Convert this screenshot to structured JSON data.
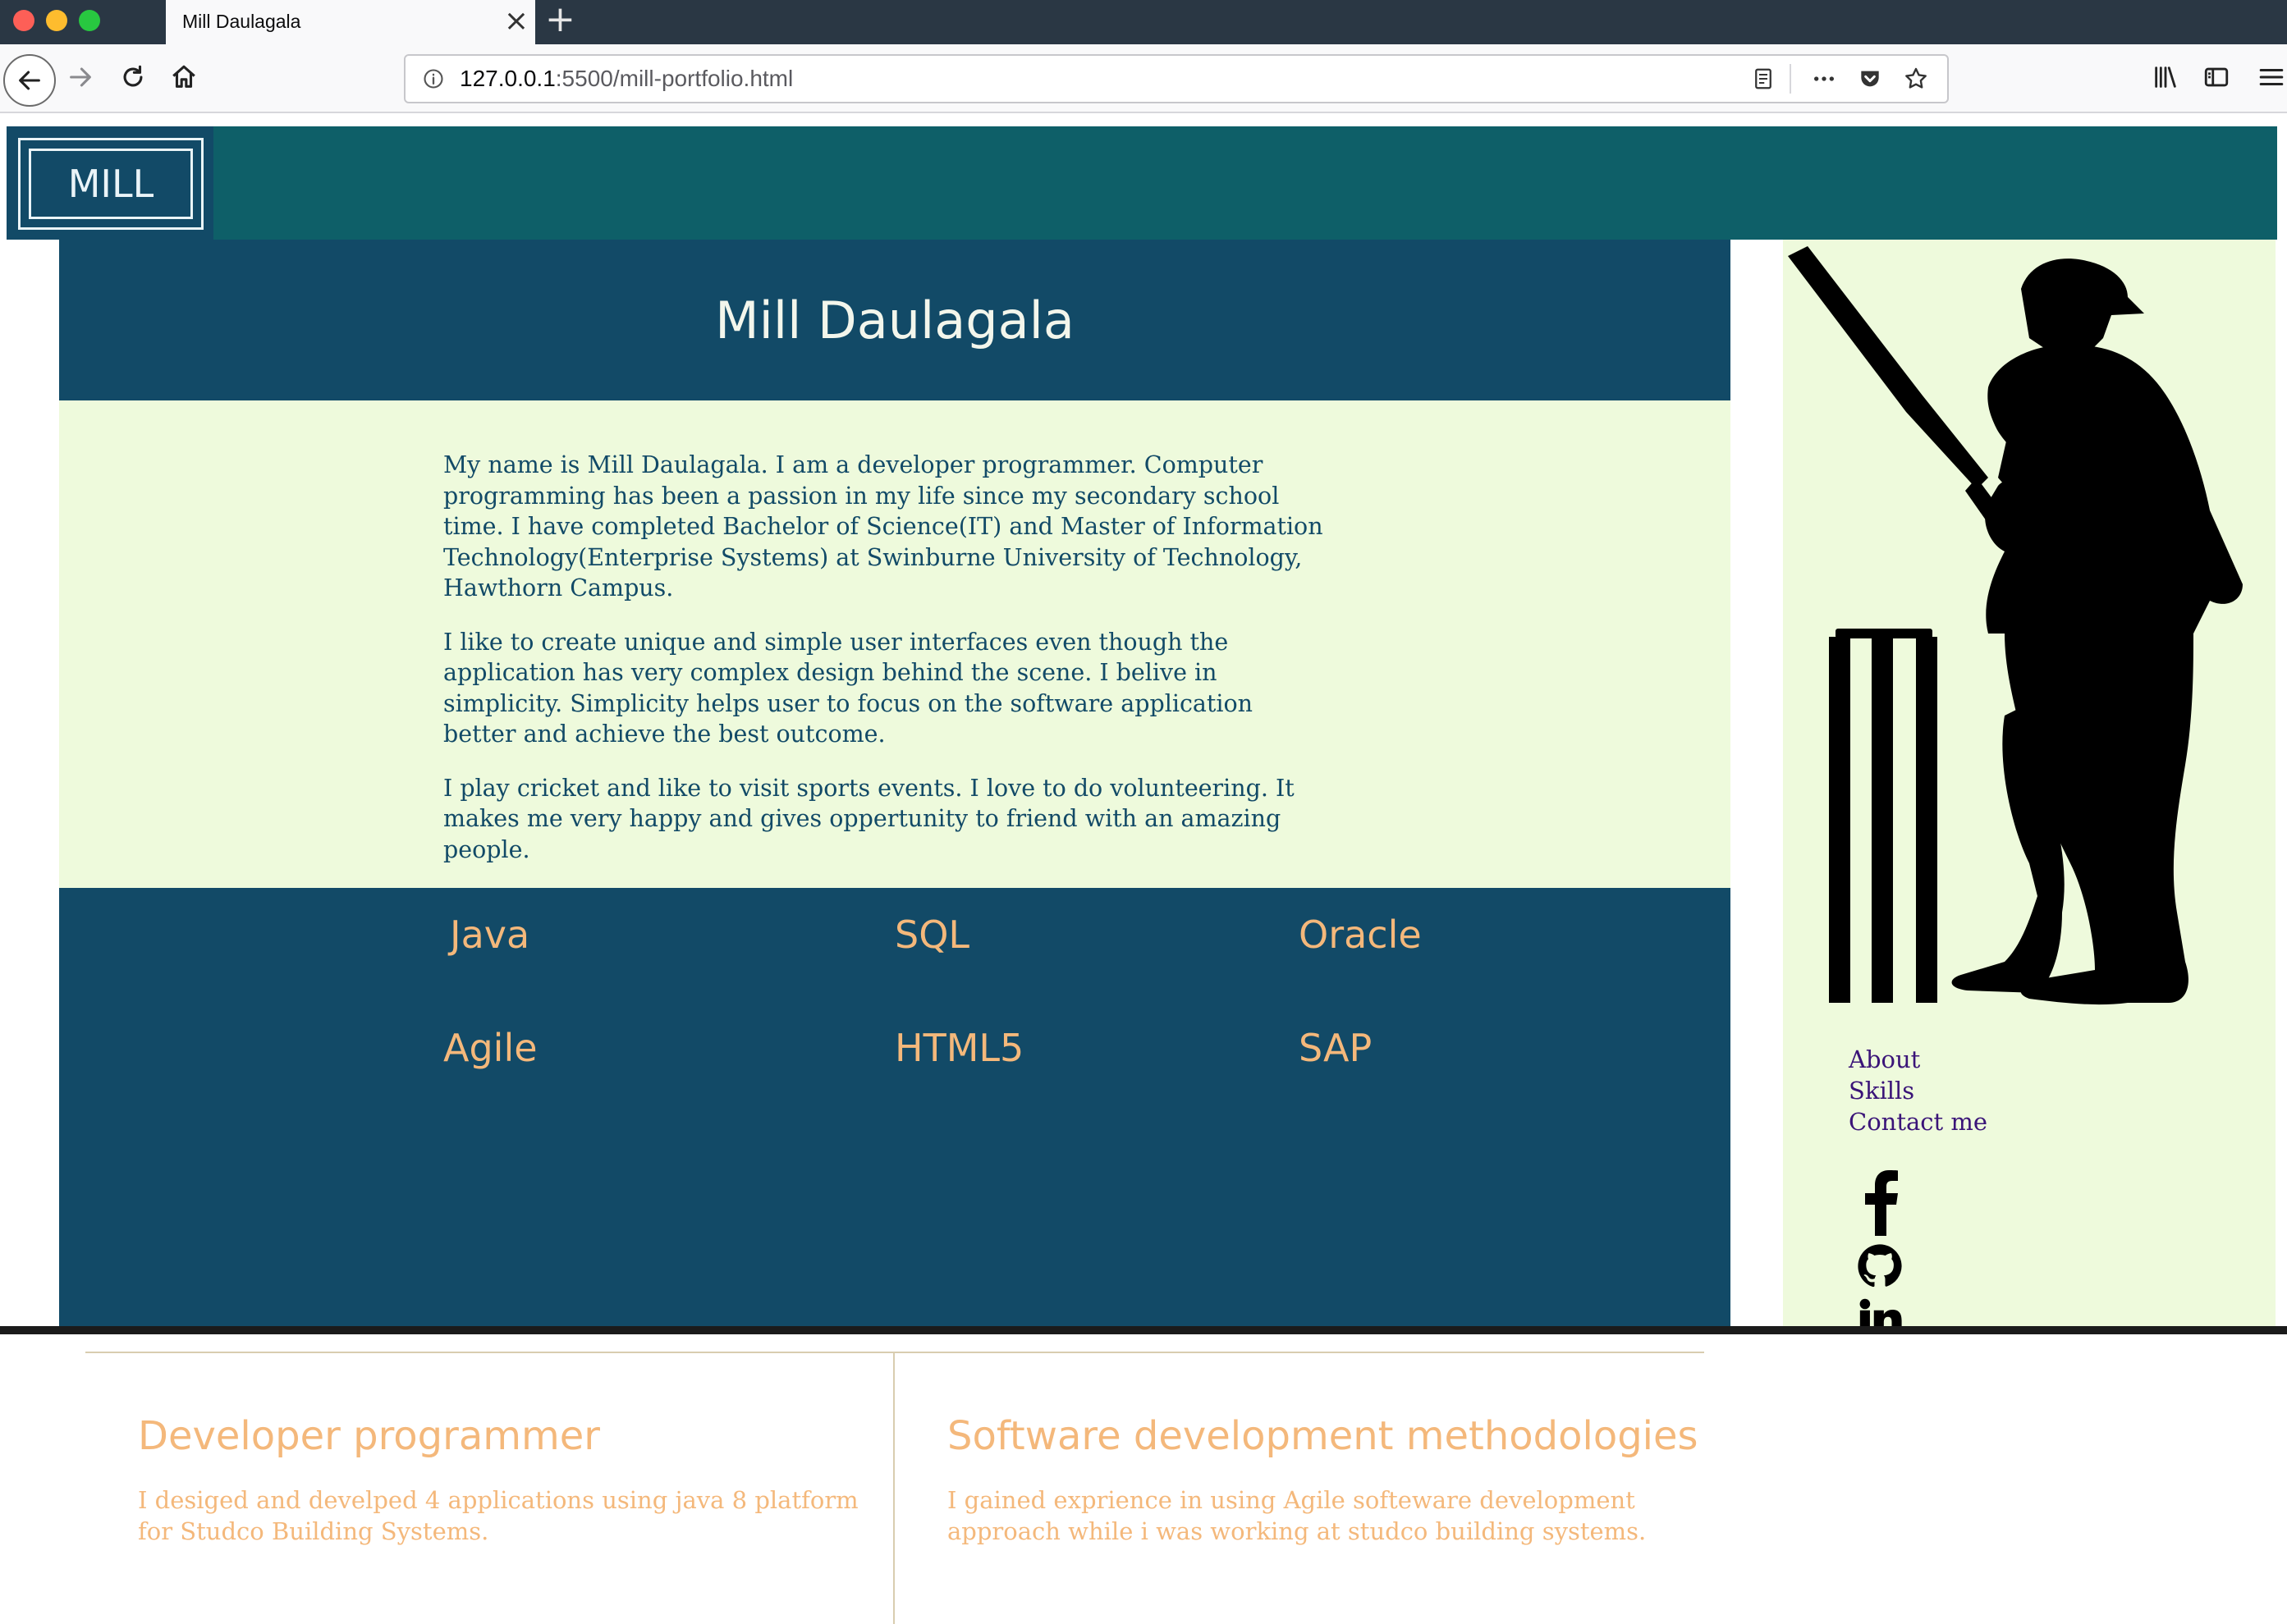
{
  "browser": {
    "tab_title": "Mill Daulagala",
    "url_host": "127.0.0.1",
    "url_rest": ":5500/mill-portfolio.html"
  },
  "header": {
    "logo": "MILL"
  },
  "hero": {
    "title": "Mill Daulagala"
  },
  "about": {
    "paragraphs": [
      "My name is Mill Daulagala. I am a developer programmer. Computer programming has been a passion in my life since my secondary school time. I have completed Bachelor of Science(IT) and Master of Information Technology(Enterprise Systems) at Swinburne University of Technology, Hawthorn Campus.",
      "I like to create unique and simple user interfaces even though the application has very complex design behind the scene. I belive in simplicity. Simplicity helps user to focus on the software application better and achieve the best outcome.",
      "I play cricket and like to visit sports events. I love to do volunteering. It makes me very happy and gives oppertunity to friend with an amazing people."
    ]
  },
  "skills": [
    "Java",
    "SQL",
    "Oracle",
    "Agile",
    "HTML5",
    "SAP"
  ],
  "cards": [
    {
      "title": "Developer programmer",
      "text": "I desiged and develped 4 applications using java 8 platform for Studco Building Systems."
    },
    {
      "title": "Software development methodologies",
      "text": "I gained exprience in using Agile softeware development approach while i was working at studco building systems."
    }
  ],
  "sidebar": {
    "links": [
      "About",
      "Skills",
      "Contact me"
    ],
    "social_icons": [
      "facebook-icon",
      "github-icon",
      "linkedin-icon"
    ]
  },
  "colors": {
    "header_teal": "#0e5f68",
    "navy": "#124a67",
    "cream": "#eefadc",
    "accent_orange": "#f4b87b",
    "link_purple": "#3a1478"
  }
}
